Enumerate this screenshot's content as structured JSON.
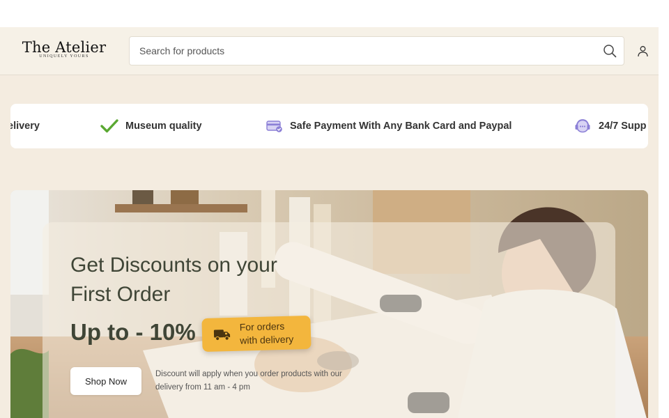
{
  "brand": {
    "name": "The Atelier",
    "tagline": "UNIQUELY YOURS"
  },
  "search": {
    "placeholder": "Search for products"
  },
  "features": [
    {
      "icon": "truck-icon",
      "label": "elivery"
    },
    {
      "icon": "check-icon",
      "label": "Museum quality"
    },
    {
      "icon": "card-icon",
      "label": "Safe Payment With Any Bank Card and Paypal"
    },
    {
      "icon": "support-icon",
      "label": "24/7 Supp"
    }
  ],
  "hero": {
    "title": "Get Discounts on your First Order",
    "discount": "Up to - 10%",
    "badge": {
      "line1": "For orders",
      "line2": "with delivery"
    },
    "cta": "Shop Now",
    "note": "Discount will apply when you order products with our delivery from 11 am - 4 pm"
  },
  "colors": {
    "accent_green": "#5aa832",
    "accent_purple": "#8b7fd6",
    "badge_yellow": "#f3b63d",
    "header_bg": "#f6f1e7",
    "page_bg": "#f4ece0"
  }
}
